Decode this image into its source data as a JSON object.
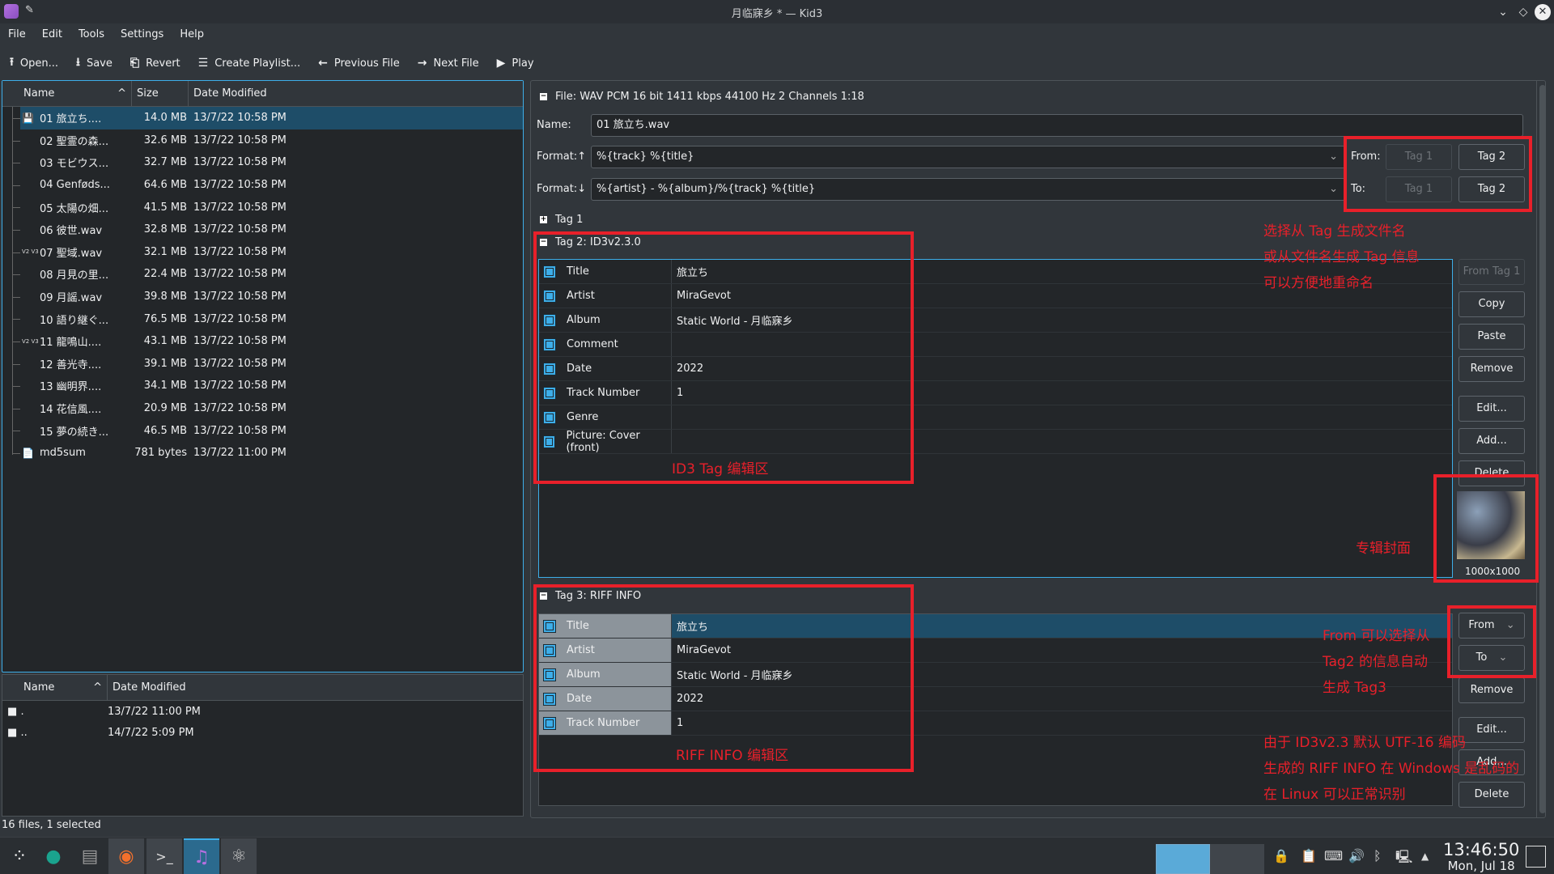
{
  "window": {
    "title": "月临寐乡 * — Kid3"
  },
  "menu": [
    "File",
    "Edit",
    "Tools",
    "Settings",
    "Help"
  ],
  "toolbar": [
    {
      "icon": "upload-icon",
      "glyph": "⭱",
      "label": "Open..."
    },
    {
      "icon": "download-icon",
      "glyph": "⭳",
      "label": "Save"
    },
    {
      "icon": "revert-icon",
      "glyph": "⎗",
      "label": "Revert"
    },
    {
      "icon": "list-icon",
      "glyph": "☰",
      "label": "Create Playlist..."
    },
    {
      "icon": "arrow-left-icon",
      "glyph": "←",
      "label": "Previous File"
    },
    {
      "icon": "arrow-right-icon",
      "glyph": "→",
      "label": "Next File"
    },
    {
      "icon": "play-icon",
      "glyph": "▶",
      "label": "Play"
    }
  ],
  "file_list": {
    "headers": {
      "name": "Name",
      "size": "Size",
      "date": "Date Modified"
    },
    "rows": [
      {
        "name": "01 旅立ち....",
        "size": "14.0 MB",
        "date": "13/7/22 10:58 PM",
        "icon": "💾",
        "selected": true
      },
      {
        "name": "02 聖霊の森...",
        "size": "32.6 MB",
        "date": "13/7/22 10:58 PM",
        "icon": ""
      },
      {
        "name": "03 モビウス...",
        "size": "32.7 MB",
        "date": "13/7/22 10:58 PM",
        "icon": ""
      },
      {
        "name": "04 Genføds...",
        "size": "64.6 MB",
        "date": "13/7/22 10:58 PM",
        "icon": ""
      },
      {
        "name": "05 太陽の畑...",
        "size": "41.5 MB",
        "date": "13/7/22 10:58 PM",
        "icon": ""
      },
      {
        "name": "06 彼世.wav",
        "size": "32.8 MB",
        "date": "13/7/22 10:58 PM",
        "icon": ""
      },
      {
        "name": "07 聖域.wav",
        "size": "32.1 MB",
        "date": "13/7/22 10:58 PM",
        "icon": "V2V3"
      },
      {
        "name": "08 月見の里...",
        "size": "22.4 MB",
        "date": "13/7/22 10:58 PM",
        "icon": ""
      },
      {
        "name": "09 月謡.wav",
        "size": "39.8 MB",
        "date": "13/7/22 10:58 PM",
        "icon": ""
      },
      {
        "name": "10 語り継ぐ...",
        "size": "76.5 MB",
        "date": "13/7/22 10:58 PM",
        "icon": ""
      },
      {
        "name": "11 龍鳴山....",
        "size": "43.1 MB",
        "date": "13/7/22 10:58 PM",
        "icon": "V2V3"
      },
      {
        "name": "12 善光寺....",
        "size": "39.1 MB",
        "date": "13/7/22 10:58 PM",
        "icon": ""
      },
      {
        "name": "13 幽明界....",
        "size": "34.1 MB",
        "date": "13/7/22 10:58 PM",
        "icon": ""
      },
      {
        "name": "14 花信風....",
        "size": "20.9 MB",
        "date": "13/7/22 10:58 PM",
        "icon": ""
      },
      {
        "name": "15 夢の続き...",
        "size": "46.5 MB",
        "date": "13/7/22 10:58 PM",
        "icon": ""
      },
      {
        "name": "md5sum",
        "size": "781 bytes",
        "date": "13/7/22 11:00 PM",
        "icon": "📄"
      }
    ]
  },
  "dir_list": {
    "headers": {
      "name": "Name",
      "date": "Date Modified"
    },
    "rows": [
      {
        "name": ".",
        "date": "13/7/22 11:00 PM",
        "icon": "folder-icon"
      },
      {
        "name": "..",
        "date": "14/7/22 5:09 PM",
        "icon": "folder-up-icon"
      }
    ]
  },
  "status": "16 files, 1 selected",
  "file_section": {
    "title": "File: WAV PCM 16 bit 1411 kbps 44100 Hz 2 Channels 1:18",
    "name_label": "Name:",
    "name_value": "01 旅立ち.wav",
    "format_up_label": "Format:↑",
    "format_up_value": "%{track} %{title}",
    "format_down_label": "Format:↓",
    "format_down_value": "%{artist} - %{album}/%{track} %{title}",
    "from_label": "From:",
    "to_label": "To:",
    "tag1": "Tag 1",
    "tag2": "Tag 2"
  },
  "tag1_title": "Tag 1",
  "tag2": {
    "title": "Tag 2: ID3v2.3.0",
    "rows": [
      {
        "k": "Title",
        "v": "旅立ち"
      },
      {
        "k": "Artist",
        "v": "MiraGevot"
      },
      {
        "k": "Album",
        "v": "Static World - 月临寐乡"
      },
      {
        "k": "Comment",
        "v": ""
      },
      {
        "k": "Date",
        "v": "2022"
      },
      {
        "k": "Track Number",
        "v": "1"
      },
      {
        "k": "Genre",
        "v": ""
      },
      {
        "k": "Picture: Cover (front)",
        "v": ""
      }
    ],
    "buttons": [
      "From Tag 1",
      "Copy",
      "Paste",
      "Remove",
      "Edit...",
      "Add...",
      "Delete"
    ],
    "cover_size": "1000x1000"
  },
  "tag3": {
    "title": "Tag 3: RIFF INFO",
    "rows": [
      {
        "k": "Title",
        "v": "旅立ち"
      },
      {
        "k": "Artist",
        "v": "MiraGevot"
      },
      {
        "k": "Album",
        "v": "Static World - 月临寐乡"
      },
      {
        "k": "Date",
        "v": "2022"
      },
      {
        "k": "Track Number",
        "v": "1"
      }
    ],
    "buttons": [
      "From",
      "To",
      "Remove",
      "Edit...",
      "Add...",
      "Delete"
    ]
  },
  "annotations": {
    "rename": [
      "选择从 Tag 生成文件名",
      "或从文件名生成 Tag 信息",
      "可以方便地重命名"
    ],
    "id3": "ID3 Tag 编辑区",
    "cover": "专辑封面",
    "riff": "RIFF INFO 编辑区",
    "from": [
      "From 可以选择从",
      "Tag2 的信息自动",
      "生成 Tag3"
    ],
    "encoding": [
      "由于 ID3v2.3 默认 UTF-16 编码",
      "生成的 RIFF INFO 在 Windows 是乱码的",
      "在 Linux 可以正常识别"
    ]
  },
  "taskbar": {
    "time": "13:46:50",
    "date": "Mon, Jul 18"
  }
}
